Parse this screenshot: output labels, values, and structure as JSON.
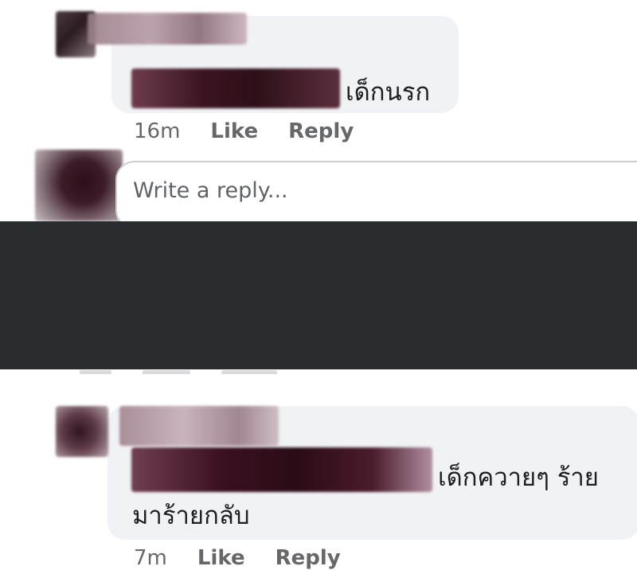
{
  "comment1": {
    "text": "เด็กนรก",
    "time": "16m",
    "like_label": "Like",
    "reply_label": "Reply"
  },
  "reply_input": {
    "placeholder": "Write a reply..."
  },
  "comment2": {
    "text_line1": "เด็กควายๆ ร้าย",
    "text_line2": "มาร้ายกลับ",
    "time": "7m",
    "like_label": "Like",
    "reply_label": "Reply"
  },
  "colors": {
    "bubble": "#f0f2f5",
    "overlay": "#2a2d30",
    "pixelation": "#5a2f3e"
  }
}
